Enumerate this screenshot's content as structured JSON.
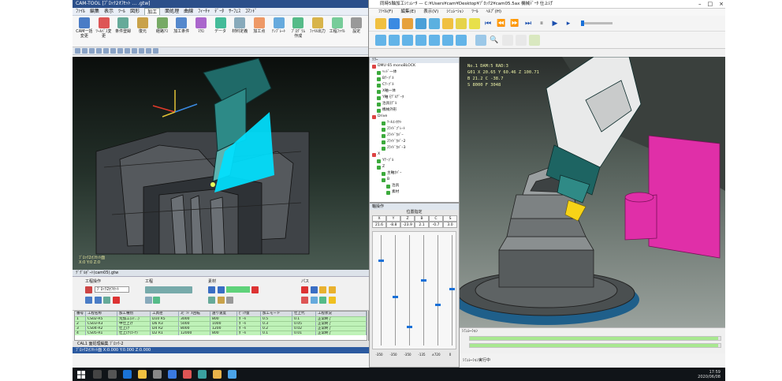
{
  "cam": {
    "window_title": "CAM-TOOL  [ﾌﾞﾛｯｸ2ｵﾌｾｯﾄ ... .gtw]",
    "menu_tabs": [
      "ﾌｧｲﾙ",
      "編集",
      "表示",
      "ﾂｰﾙ",
      "図形",
      "加工",
      "面処理",
      "曲線",
      "ﾌｨｰﾁｬ",
      "ﾃﾞｰﾀ",
      "ｻｰﾌｪｽ",
      "ｺﾏﾝﾄﾞ"
    ],
    "active_tab_index": 5,
    "ribbon_buttons": [
      "CAM一括変更",
      "ﾂｰﾙﾊﾟｽ変更",
      "条件登録",
      "復元",
      "経路ｱｽ",
      "加工条件",
      "ﾏｸﾛ",
      "データ",
      "材料定義",
      "加工点",
      "ﾃﾝﾌﾟﾚｰﾄ",
      "ﾌﾟﾛｸﾞﾗﾑ作成",
      "ﾌｧｲﾙ出力",
      "工程ﾌｧｲﾙ",
      "設定"
    ],
    "viewport_info": [
      "ﾌﾞﾛｯｸ2ｵﾌｾｯﾄ面",
      "X:0 Y:0 Z:0"
    ],
    "doc_tab": "ﾃﾞｸﾞﾙﾎﾟｰﾄ(cam05).gtw",
    "ops_groups": [
      "工程操作",
      "工程",
      "素材",
      "パス"
    ],
    "ops_select_value": "ﾌﾞﾛｯｸ2ｵﾌｾｯﾄ",
    "table_headers": [
      "番号",
      "工程名称",
      "加工種別",
      "工具径",
      "ｽﾋﾟﾝﾄﾞﾙ回転",
      "送り速度",
      "ﾋﾟｯｸ量",
      "加工モード",
      "仕上代",
      "工程状況"
    ],
    "table_rows": [
      [
        "1",
        "CS02-R5",
        "荒加工(ｽｲ...)",
        "D10 R5",
        "3000",
        "800",
        "ﾎﾞｰﾙ",
        "0.5",
        "0.1",
        "正常終了"
      ],
      [
        "2",
        "CS03-R3",
        "中仕上げ",
        "D6 R3",
        "5000",
        "1000",
        "ﾎﾞｰﾙ",
        "0.3",
        "0.05",
        "正常終了"
      ],
      [
        "3",
        "CS04-R2",
        "仕上げ",
        "D4 R2",
        "8000",
        "1200",
        "ﾎﾞｰﾙ",
        "0.2",
        "0.02",
        "正常終了"
      ],
      [
        "4",
        "CS05-R1",
        "仕上げ(ｺｰﾅ)",
        "D2 R1",
        "12000",
        "800",
        "ﾎﾞｰﾙ",
        "0.1",
        "0.01",
        "正常終了"
      ]
    ],
    "sheet_tabs": [
      "CAL1 面処理編集 ﾌﾞﾛｯｸ-2"
    ],
    "status": "ﾌﾞﾛｯｸ2ｵﾌｾｯﾄ面  X:0.000  Y:0.000  Z:0.000"
  },
  "sim": {
    "window_title": "同時5軸加工ｼﾐｭﾚｰﾀ — C:¥Users¥cam¥Desktop¥ﾌﾞﾛｯｸ2¥cam05.5ax 機械ﾃﾞｰﾀ 仕上げ",
    "menu": [
      "ﾌｧｲﾙ(F)",
      "編集(E)",
      "表示(V)",
      "ｼﾐｭﾚｰｼｮﾝ",
      "ﾂｰﾙ",
      "ﾍﾙﾌﾟ(H)"
    ],
    "tree_title": "ﾂﾘｰ",
    "tree_nodes": [
      {
        "label": "DMU 65 monoBLOCK",
        "indent": 0
      },
      {
        "label": "ﾍｯﾄﾞ一体",
        "indent": 1
      },
      {
        "label": "Bﾃｰﾌﾞﾙ",
        "indent": 1
      },
      {
        "label": "Cﾃｰﾌﾞﾙ",
        "indent": 1
      },
      {
        "label": "X軸一体",
        "indent": 1
      },
      {
        "label": "Y軸 ﾓﾃﾞﾙﾃﾞｰﾀ",
        "indent": 1
      },
      {
        "label": "治具ﾓﾃﾞﾙ",
        "indent": 1
      },
      {
        "label": "機械外形",
        "indent": 1
      },
      {
        "label": "Drive",
        "indent": 0
      },
      {
        "label": "ﾂｰﾙｺﾝﾀｸﾄ",
        "indent": 2
      },
      {
        "label": "ｽﾗｲﾄﾞﾌﾟﾚｰﾄ",
        "indent": 2
      },
      {
        "label": "ｽﾗｲﾄﾞｶﾊﾞｰ",
        "indent": 2
      },
      {
        "label": "ｽﾗｲﾄﾞｶﾊﾞｰ2",
        "indent": 2
      },
      {
        "label": "ｽﾗｲﾄﾞｶﾊﾞｰ3",
        "indent": 2
      },
      {
        "label": "X",
        "indent": 0
      },
      {
        "label": "Yﾃｰﾌﾞﾙ",
        "indent": 1
      },
      {
        "label": "Z",
        "indent": 1
      },
      {
        "label": "主軸ｶﾊﾞｰ",
        "indent": 2
      },
      {
        "label": "B",
        "indent": 2
      },
      {
        "label": "治具",
        "indent": 3
      },
      {
        "label": "素材",
        "indent": 3
      }
    ],
    "axes_title": "軸操作",
    "axes_sub": "位置指定",
    "axes": [
      "X",
      "Y",
      "Z",
      "B",
      "C",
      "S"
    ],
    "axis_values": [
      "21.6",
      "-8.8",
      "-23.9",
      "2.1",
      "-0.7",
      "3.0"
    ],
    "slider_levels": [
      0.22,
      0.55,
      0.82,
      0.4,
      0.62,
      0.48
    ],
    "slider_scale": [
      "-350",
      "-350",
      "-350",
      "-135",
      "±720",
      "0"
    ],
    "nc_readout": [
      "No.1  DAM:5  RAD:3",
      "G01  X 20.65  Y 60.46  Z 100.71",
      "      B 21.2   C -38.7",
      "S 8000  F 3048"
    ],
    "progress_label": "ｼﾐｭﾚｰｼｮﾝ",
    "progress_top": 0.99,
    "progress_bottom": 0.99,
    "status": "ｼﾐｭﾚｰｼｮﾝ実行中"
  },
  "taskbar": {
    "time": "17:59",
    "date": "2020/06/08"
  },
  "colors": {
    "accent": "#2c5aa0",
    "cyan": "#00e1ff",
    "magenta": "#e02fa8",
    "table_green": "#bff2b8"
  }
}
